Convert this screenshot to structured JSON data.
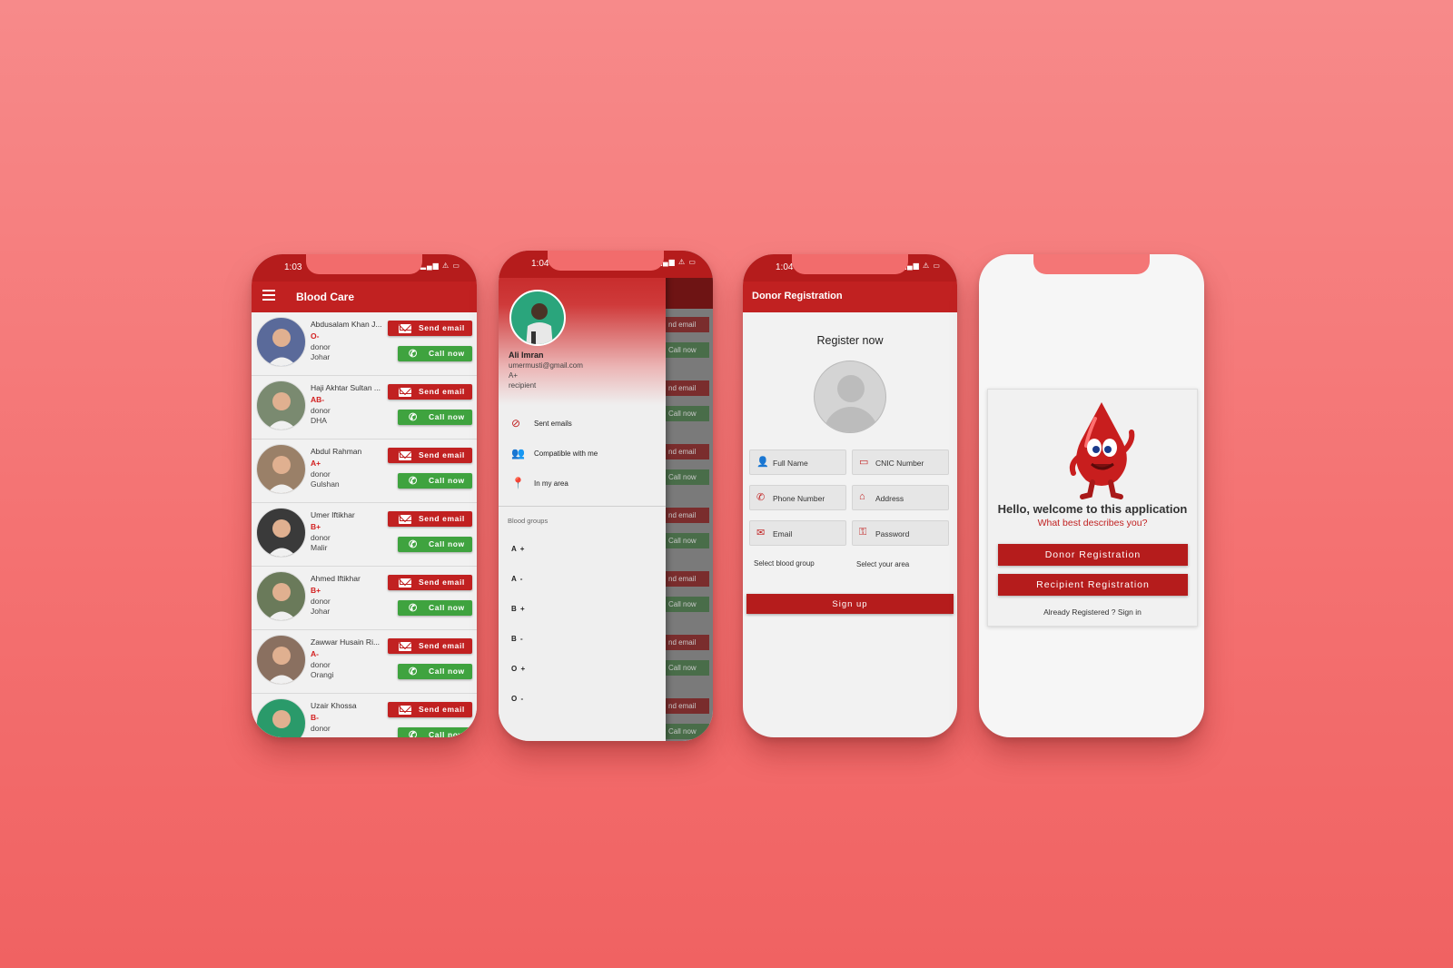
{
  "colors": {
    "primary": "#c12121",
    "call": "#3fa33f"
  },
  "donor_list_screen": {
    "time": "1:03",
    "title": "Blood Care",
    "email_label": "Send email",
    "call_label": "Call now",
    "donors": [
      {
        "name": "Abdusalam Khan J...",
        "group": "O-",
        "type": "donor",
        "area": "Johar"
      },
      {
        "name": "Haji Akhtar Sultan ...",
        "group": "AB-",
        "type": "donor",
        "area": "DHA"
      },
      {
        "name": "Abdul Rahman",
        "group": "A+",
        "type": "donor",
        "area": "Gulshan"
      },
      {
        "name": "Umer Iftikhar",
        "group": "B+",
        "type": "donor",
        "area": "Malir"
      },
      {
        "name": "Ahmed Iftikhar",
        "group": "B+",
        "type": "donor",
        "area": "Johar"
      },
      {
        "name": "Zawwar Husain Ri...",
        "group": "A-",
        "type": "donor",
        "area": "Orangi"
      },
      {
        "name": "Uzair Khossa",
        "group": "B-",
        "type": "donor",
        "area": ""
      }
    ]
  },
  "drawer_screen": {
    "time": "1:04",
    "user": {
      "name": "Ali Imran",
      "email": "umermusti@gmail.com",
      "group": "A+",
      "role": "recipient"
    },
    "menu": [
      {
        "label": "Sent emails",
        "icon": "check-circle-icon"
      },
      {
        "label": "Compatible with me",
        "icon": "people-icon"
      },
      {
        "label": "In my area",
        "icon": "location-pin-icon"
      }
    ],
    "blood_groups_title": "Blood groups",
    "blood_groups": [
      "A +",
      "A -",
      "B +",
      "B -",
      "O +",
      "O -"
    ],
    "behind_email": "nd email",
    "behind_call": "Call now"
  },
  "registration_screen": {
    "time": "1:04",
    "title": "Donor Registration",
    "heading": "Register now",
    "fields": {
      "full_name": "Full Name",
      "cnic": "CNIC Number",
      "phone": "Phone Number",
      "address": "Address",
      "email": "Email",
      "password": "Password"
    },
    "select_blood_group": "Select blood group",
    "select_area": "Select your area",
    "signup": "Sign up"
  },
  "welcome_screen": {
    "title": "Hello, welcome to this application",
    "subtitle": "What best describes you?",
    "donor_button": "Donor Registration",
    "recipient_button": "Recipient Registration",
    "signin": "Already Registered ? Sign in"
  }
}
